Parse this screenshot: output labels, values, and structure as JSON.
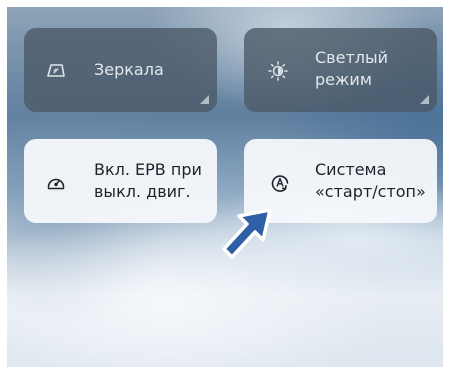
{
  "tiles": {
    "mirrors": {
      "label": "Зеркала",
      "icon": "mirror-icon"
    },
    "light_mode": {
      "label": "Светлый\nрежим",
      "icon": "brightness-icon"
    },
    "epb": {
      "label": "Вкл. EPB при\nвыкл. двиг.",
      "icon": "parking-brake-icon"
    },
    "start_stop": {
      "label": "Система\n«старт/стоп»",
      "icon": "auto-start-stop-icon"
    }
  },
  "colors": {
    "pointer_fill": "#2f5fa6",
    "dark_tile": "#4a5866",
    "light_tile": "#f6f8fb"
  }
}
